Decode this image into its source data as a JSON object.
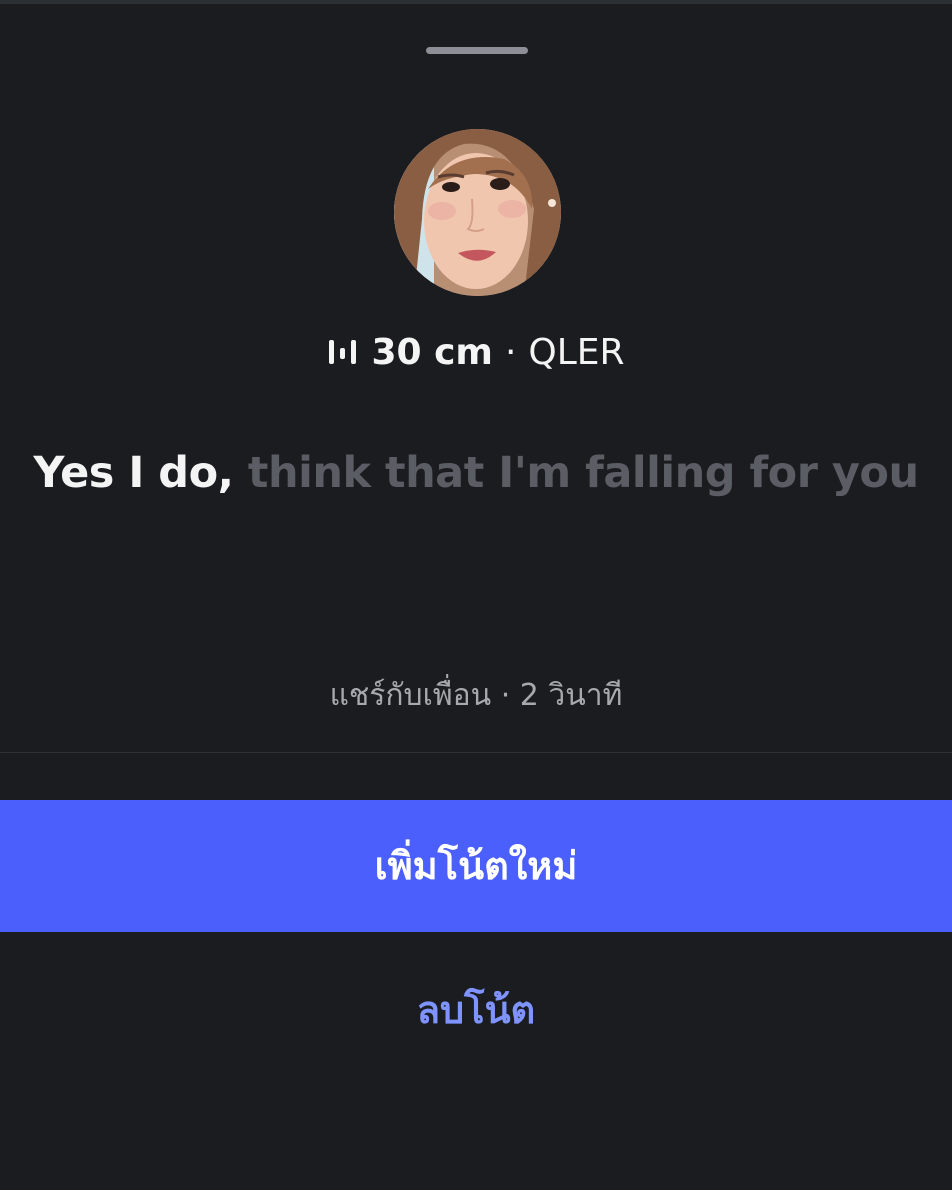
{
  "note": {
    "song_title": "30 cm",
    "separator": "·",
    "artist": "QLER",
    "lyric_active": "Yes I do,",
    "lyric_upcoming": " think that I'm falling for you",
    "audience": "แชร์กับเพื่อน",
    "time_separator": "·",
    "time_ago": "2 วินาที"
  },
  "actions": {
    "new_note_label": "เพิ่มโน้ตใหม่",
    "delete_note_label": "ลบโน้ต"
  },
  "icons": {
    "music": "music-bars-icon"
  },
  "colors": {
    "background": "#1a1c20",
    "accent": "#4a5ffb",
    "link": "#7f93ff",
    "muted_text": "#a6a9ae",
    "upcoming_lyric": "#5a5d63"
  }
}
